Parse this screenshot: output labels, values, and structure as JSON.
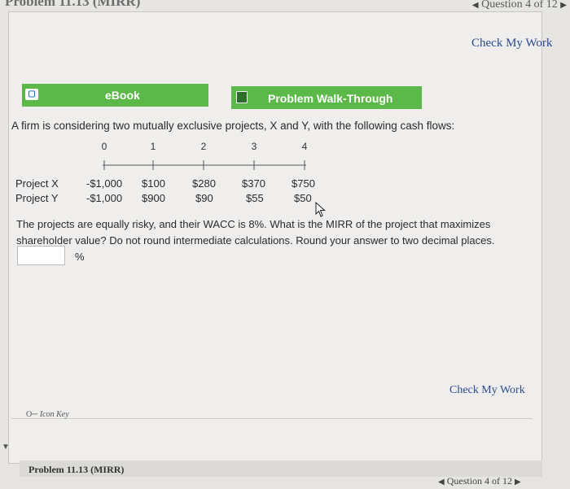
{
  "header": {
    "problem_title": "Problem 11.13 (MIRR)",
    "question_nav": "Question 4 of 12"
  },
  "actions": {
    "check_my_work": "Check My Work",
    "ebook": "eBook",
    "walkthrough": "Problem Walk-Through"
  },
  "question": {
    "intro": "A firm is considering two mutually exclusive projects, X and Y, with the following cash flows:",
    "timeline_labels": [
      "0",
      "1",
      "2",
      "3",
      "4"
    ],
    "projects": [
      {
        "name": "Project X",
        "cash_flows": [
          "-$1,000",
          "$100",
          "$280",
          "$370",
          "$750"
        ]
      },
      {
        "name": "Project Y",
        "cash_flows": [
          "-$1,000",
          "$900",
          "$90",
          "$55",
          "$50"
        ]
      }
    ],
    "instructions": "The projects are equally risky, and their WACC is 8%. What is the MIRR of the project that maximizes shareholder value? Do not round intermediate calculations. Round your answer to two decimal places.",
    "answer_value": "",
    "unit": "%"
  },
  "footer": {
    "icon_key": "Icon Key",
    "problem_title": "Problem 11.13 (MIRR)",
    "question_nav": "Question 4 of 12"
  },
  "colors": {
    "button_green": "#5db84a",
    "link_blue": "#2c4a8f"
  },
  "icons": [
    "book-icon",
    "walkthrough-icon",
    "key-icon",
    "cursor-icon"
  ]
}
